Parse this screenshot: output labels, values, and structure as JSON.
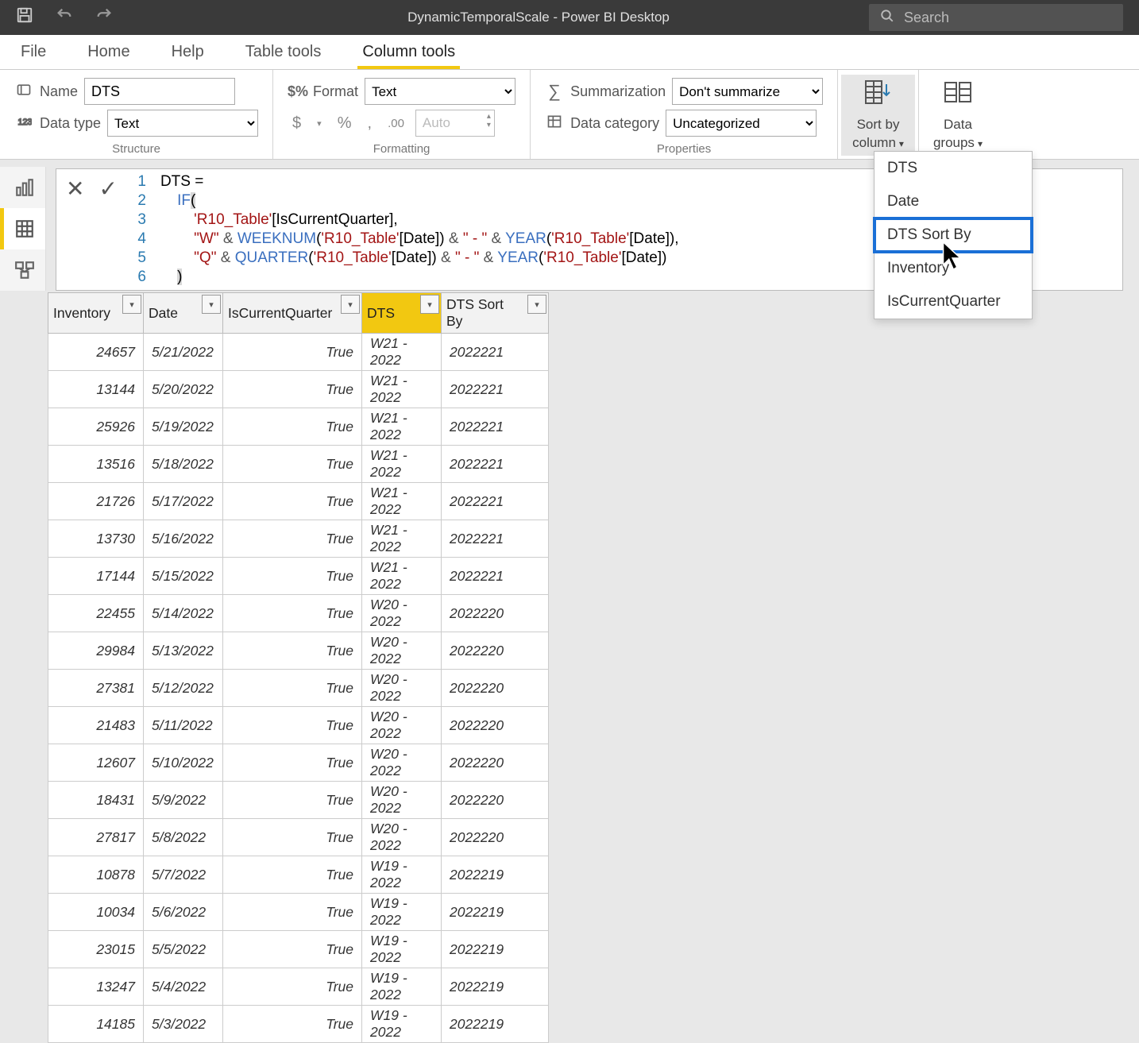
{
  "title": "DynamicTemporalScale - Power BI Desktop",
  "search_placeholder": "Search",
  "tabs": {
    "file": "File",
    "home": "Home",
    "help": "Help",
    "table_tools": "Table tools",
    "column_tools": "Column tools"
  },
  "ribbon": {
    "structure": {
      "name_label": "Name",
      "name_value": "DTS",
      "datatype_label": "Data type",
      "datatype_value": "Text",
      "group_label": "Structure"
    },
    "formatting": {
      "format_label": "Format",
      "format_value": "Text",
      "auto_label": "Auto",
      "currency": "$",
      "percent": "%",
      "comma": ",",
      "decimals": ".00",
      "group_label": "Formatting"
    },
    "properties": {
      "summarization_label": "Summarization",
      "summarization_value": "Don't summarize",
      "datacategory_label": "Data category",
      "datacategory_value": "Uncategorized",
      "group_label": "Properties"
    },
    "sort_by_column": {
      "line1": "Sort by",
      "line2": "column"
    },
    "data_groups": {
      "line1": "Data",
      "line2": "groups"
    }
  },
  "formula": {
    "lines": [
      {
        "n": 1,
        "raw": "DTS ="
      },
      {
        "n": 2,
        "raw": "IF("
      },
      {
        "n": 3,
        "raw": "'R10_Table'[IsCurrentQuarter],"
      },
      {
        "n": 4,
        "raw": "\"W\" & WEEKNUM('R10_Table'[Date]) & \" - \" & YEAR('R10_Table'[Date]),"
      },
      {
        "n": 5,
        "raw": "\"Q\" & QUARTER('R10_Table'[Date]) & \" - \" & YEAR('R10_Table'[Date])"
      },
      {
        "n": 6,
        "raw": ")"
      }
    ]
  },
  "columns": {
    "inventory": "Inventory",
    "date": "Date",
    "iscurrentquarter": "IsCurrentQuarter",
    "dts": "DTS",
    "dtssortby": "DTS Sort By"
  },
  "rows": [
    {
      "inv": "24657",
      "date": "5/21/2022",
      "icq": "True",
      "dts": "W21 - 2022",
      "sort": "2022221"
    },
    {
      "inv": "13144",
      "date": "5/20/2022",
      "icq": "True",
      "dts": "W21 - 2022",
      "sort": "2022221"
    },
    {
      "inv": "25926",
      "date": "5/19/2022",
      "icq": "True",
      "dts": "W21 - 2022",
      "sort": "2022221"
    },
    {
      "inv": "13516",
      "date": "5/18/2022",
      "icq": "True",
      "dts": "W21 - 2022",
      "sort": "2022221"
    },
    {
      "inv": "21726",
      "date": "5/17/2022",
      "icq": "True",
      "dts": "W21 - 2022",
      "sort": "2022221"
    },
    {
      "inv": "13730",
      "date": "5/16/2022",
      "icq": "True",
      "dts": "W21 - 2022",
      "sort": "2022221"
    },
    {
      "inv": "17144",
      "date": "5/15/2022",
      "icq": "True",
      "dts": "W21 - 2022",
      "sort": "2022221"
    },
    {
      "inv": "22455",
      "date": "5/14/2022",
      "icq": "True",
      "dts": "W20 - 2022",
      "sort": "2022220"
    },
    {
      "inv": "29984",
      "date": "5/13/2022",
      "icq": "True",
      "dts": "W20 - 2022",
      "sort": "2022220"
    },
    {
      "inv": "27381",
      "date": "5/12/2022",
      "icq": "True",
      "dts": "W20 - 2022",
      "sort": "2022220"
    },
    {
      "inv": "21483",
      "date": "5/11/2022",
      "icq": "True",
      "dts": "W20 - 2022",
      "sort": "2022220"
    },
    {
      "inv": "12607",
      "date": "5/10/2022",
      "icq": "True",
      "dts": "W20 - 2022",
      "sort": "2022220"
    },
    {
      "inv": "18431",
      "date": "5/9/2022",
      "icq": "True",
      "dts": "W20 - 2022",
      "sort": "2022220"
    },
    {
      "inv": "27817",
      "date": "5/8/2022",
      "icq": "True",
      "dts": "W20 - 2022",
      "sort": "2022220"
    },
    {
      "inv": "10878",
      "date": "5/7/2022",
      "icq": "True",
      "dts": "W19 - 2022",
      "sort": "2022219"
    },
    {
      "inv": "10034",
      "date": "5/6/2022",
      "icq": "True",
      "dts": "W19 - 2022",
      "sort": "2022219"
    },
    {
      "inv": "23015",
      "date": "5/5/2022",
      "icq": "True",
      "dts": "W19 - 2022",
      "sort": "2022219"
    },
    {
      "inv": "13247",
      "date": "5/4/2022",
      "icq": "True",
      "dts": "W19 - 2022",
      "sort": "2022219"
    },
    {
      "inv": "14185",
      "date": "5/3/2022",
      "icq": "True",
      "dts": "W19 - 2022",
      "sort": "2022219"
    }
  ],
  "sort_dropdown": {
    "items": [
      "DTS",
      "Date",
      "DTS Sort By",
      "Inventory",
      "IsCurrentQuarter"
    ],
    "highlighted_index": 2
  }
}
